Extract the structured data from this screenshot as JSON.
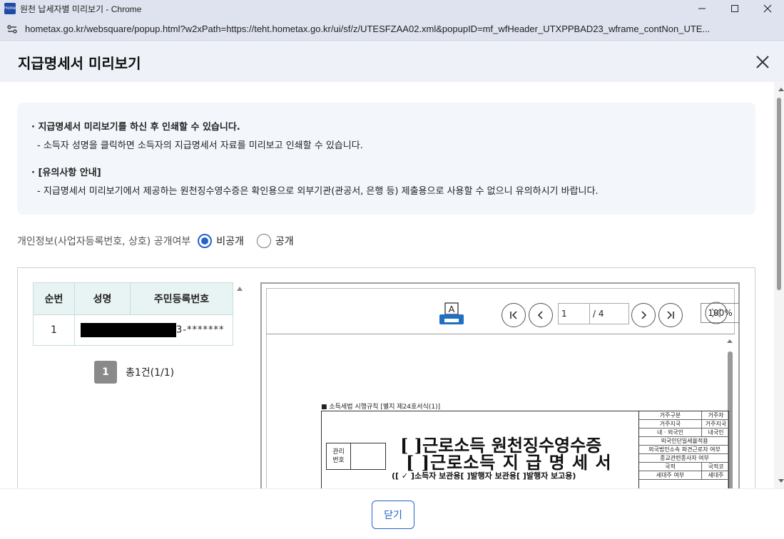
{
  "window": {
    "icon_text": "Home",
    "title": "원천 납세자별 미리보기 - Chrome"
  },
  "address": {
    "url": "hometax.go.kr/websquare/popup.html?w2xPath=https://teht.hometax.go.kr/ui/sf/z/UTESFZAA02.xml&popupID=mf_wfHeader_UTXPPBAD23_wframe_contNon_UTE..."
  },
  "popup": {
    "title": "지급명세서 미리보기"
  },
  "notice": {
    "line1": "지급명세서 미리보기를 하신 후 인쇄할 수 있습니다.",
    "line2": "- 소득자 성명을 클릭하면 소득자의 지급명세서 자료를 미리보고 인쇄할 수 있습니다.",
    "line3": "[유의사항 안내]",
    "line4": "- 지급명세서 미리보기에서 제공하는 원천징수영수증은 확인용으로 외부기관(관공서, 은행 등) 제출용으로 사용할 수 없으니 유의하시기 바랍니다."
  },
  "privacy": {
    "label": "개인정보(사업자등록번호, 상호) 공개여부",
    "option_private": "비공개",
    "option_public": "공개",
    "selected": "비공개"
  },
  "list": {
    "headers": [
      "순번",
      "성명",
      "주민등록번호"
    ],
    "rows": [
      {
        "no": "1",
        "ssn_suffix": "3-*******"
      }
    ],
    "page": "1",
    "total": "총1건(1/1)"
  },
  "viewer": {
    "page_current": "1",
    "page_total": "/ 4",
    "zoom": "100%"
  },
  "document": {
    "legal": "■ 소득세법 시행규칙 [별지 제24호서식(1)]",
    "mgmt_label": "관리\n번호",
    "title1": "[  ]근로소득 원천징수영수증",
    "title2": "[  ]근로소득 지 급 명 세 서",
    "subtitle": "([ ✓ ]소득자 보관용[      ]발행자 보관용[      ]발행자 보고용)",
    "grid": [
      [
        "거주구분",
        "거주자"
      ],
      [
        "거주지국",
        "거주지국"
      ],
      [
        "내 · 외국인",
        "내국인"
      ],
      [
        "외국인단일세율적용",
        ""
      ],
      [
        "외국법인소속 파견근로자 여부",
        ""
      ],
      [
        "종교관련종사자 여부",
        ""
      ],
      [
        "국적",
        "국적코"
      ],
      [
        "세대주 여부",
        "세대주"
      ]
    ]
  },
  "footer": {
    "close_label": "닫기"
  }
}
